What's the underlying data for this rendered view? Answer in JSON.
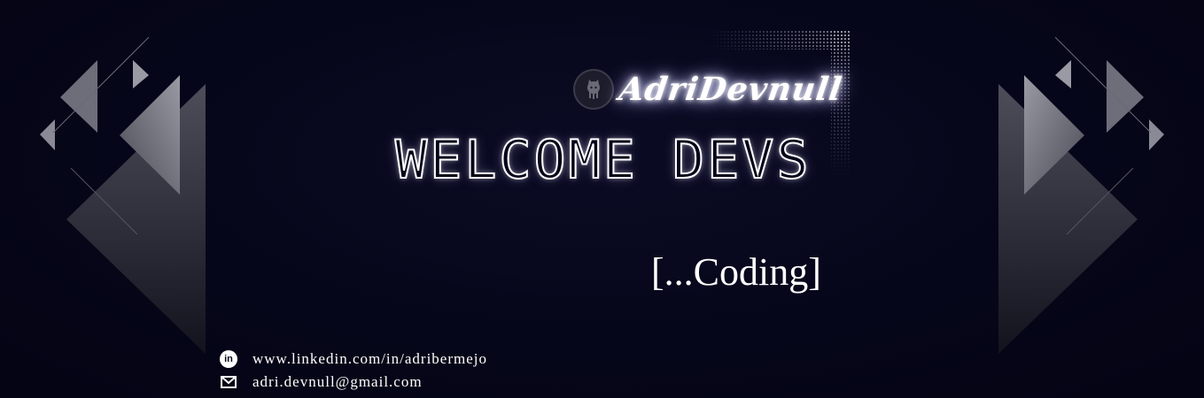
{
  "brand": {
    "logo_text": "AdriDevnull",
    "logo_icon": "github-octocat-icon"
  },
  "headline": "WELCOME DEVS",
  "tagline": "[...Coding]",
  "contacts": {
    "linkedin": {
      "icon": "linkedin-icon",
      "text": "www.linkedin.com/in/adribermejo"
    },
    "email": {
      "icon": "mail-icon",
      "text": "adri.devnull@gmail.com"
    }
  },
  "colors": {
    "background": "#05051a",
    "text": "#ffffff",
    "decoration": "#8a8a96"
  }
}
